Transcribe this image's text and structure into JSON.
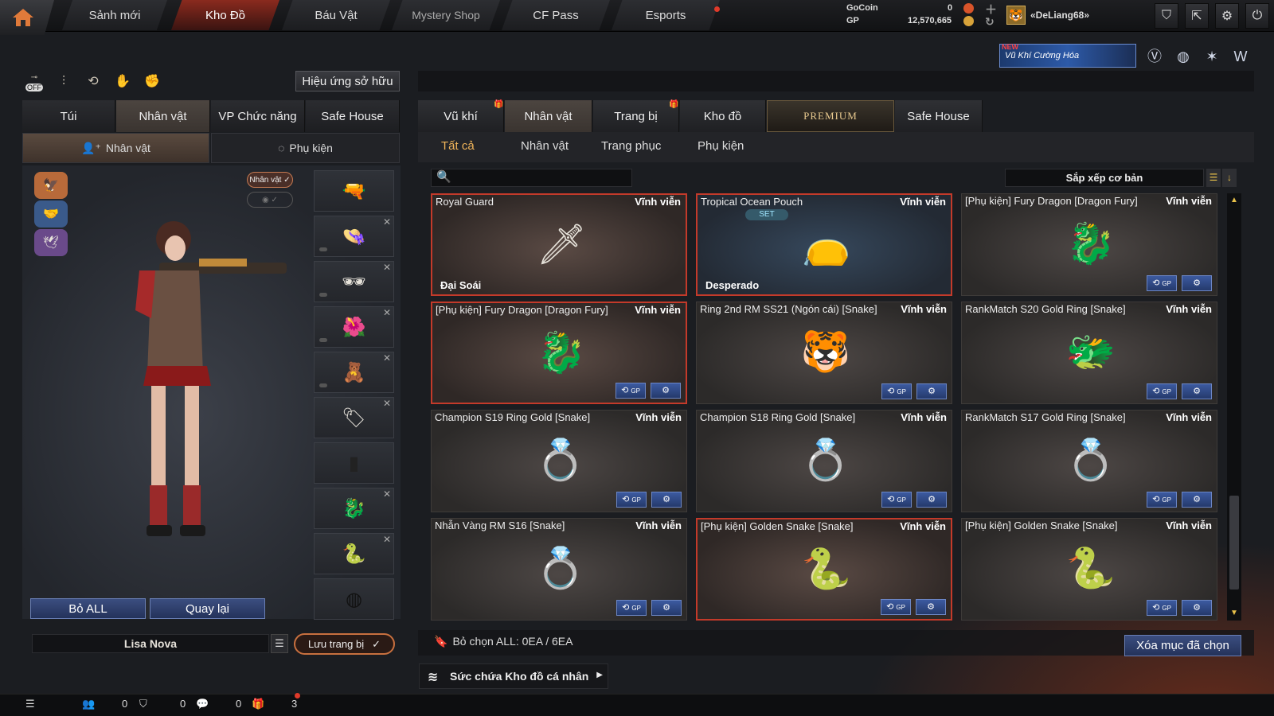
{
  "nav": {
    "items": [
      "Sảnh mới",
      "Kho Đồ",
      "Báu Vật",
      "Mystery Shop",
      "CF Pass",
      "Esports"
    ],
    "active": "Kho Đồ"
  },
  "currency": {
    "gocoin_label": "GoCoin",
    "gocoin_value": "0",
    "gp_label": "GP",
    "gp_value": "12,570,665"
  },
  "user": {
    "name": "«DeLiang68»"
  },
  "banner": {
    "new": "NEW",
    "text": "Vũ Khí Cường Hóa"
  },
  "left": {
    "effect_button": "Hiệu ứng sở hữu",
    "tabs": [
      "Túi",
      "Nhân vật",
      "VP Chức năng",
      "Safe House"
    ],
    "active_tab": "Nhân vật",
    "subtabs": [
      "Nhân vật",
      "Phụ kiện"
    ],
    "toggle_off": "OFF",
    "chip_label": "Nhân vật ✓",
    "clear_all": "Bỏ ALL",
    "back": "Quay lại",
    "character_name": "Lisa Nova",
    "save_equip": "Lưu trang bị"
  },
  "right": {
    "tabs": [
      "Vũ khí",
      "Nhân vật",
      "Trang bị",
      "Kho đồ",
      "PREMIUM",
      "Safe House"
    ],
    "active_tab": "Nhân vật",
    "subtabs": [
      "Tất cả",
      "Nhân vật",
      "Trang phục",
      "Phụ kiện"
    ],
    "active_subtab": "Tất cả",
    "sort_label": "Sắp xếp cơ bản",
    "selected_text": "Bỏ chọn ALL: 0EA / 6EA",
    "delete_button": "Xóa mục đã chọn",
    "capacity": "Sức chứa Kho đồ cá nhân",
    "gp_tag": "GP"
  },
  "items": [
    {
      "name": "Royal Guard",
      "perm": "Vĩnh viễn",
      "sub": "Đại Soái",
      "icon": "🗡",
      "style": "red"
    },
    {
      "name": "Tropical Ocean Pouch",
      "perm": "Vĩnh viễn",
      "sub": "Desperado",
      "icon": "👝",
      "style": "blue",
      "set": "SET"
    },
    {
      "name": "[Phụ kiện] Fury Dragon [Dragon Fury]",
      "perm": "Vĩnh viễn",
      "icon": "🐉",
      "style": "normal"
    },
    {
      "name": "[Phụ kiện] Fury Dragon [Dragon Fury]",
      "perm": "Vĩnh viễn",
      "icon": "🐉",
      "style": "red"
    },
    {
      "name": "Ring 2nd RM SS21 (Ngón cái) [Snake]",
      "perm": "Vĩnh viễn",
      "icon": "🐯",
      "style": "normal"
    },
    {
      "name": "RankMatch S20 Gold Ring [Snake]",
      "perm": "Vĩnh viễn",
      "icon": "🐲",
      "style": "normal"
    },
    {
      "name": "Champion S19 Ring Gold [Snake]",
      "perm": "Vĩnh viễn",
      "icon": "💍",
      "style": "normal"
    },
    {
      "name": "Champion S18 Ring Gold [Snake]",
      "perm": "Vĩnh viễn",
      "icon": "💍",
      "style": "normal"
    },
    {
      "name": "RankMatch S17 Gold Ring [Snake]",
      "perm": "Vĩnh viễn",
      "icon": "💍",
      "style": "normal"
    },
    {
      "name": "Nhẫn Vàng RM S16 [Snake]",
      "perm": "Vĩnh viễn",
      "icon": "💍",
      "style": "normal"
    },
    {
      "name": "[Phụ kiện] Golden Snake [Snake]",
      "perm": "Vĩnh viễn",
      "icon": "🐍",
      "style": "red"
    },
    {
      "name": "[Phụ kiện] Golden Snake [Snake]",
      "perm": "Vĩnh viễn",
      "icon": "🐍",
      "style": "normal"
    }
  ],
  "status": {
    "c1": "0",
    "c2": "0",
    "c3": "0",
    "c4": "3"
  },
  "colors": {
    "accent": "#c33a2a",
    "button_blue": "#3b4e80",
    "gold": "#e8c14a"
  }
}
